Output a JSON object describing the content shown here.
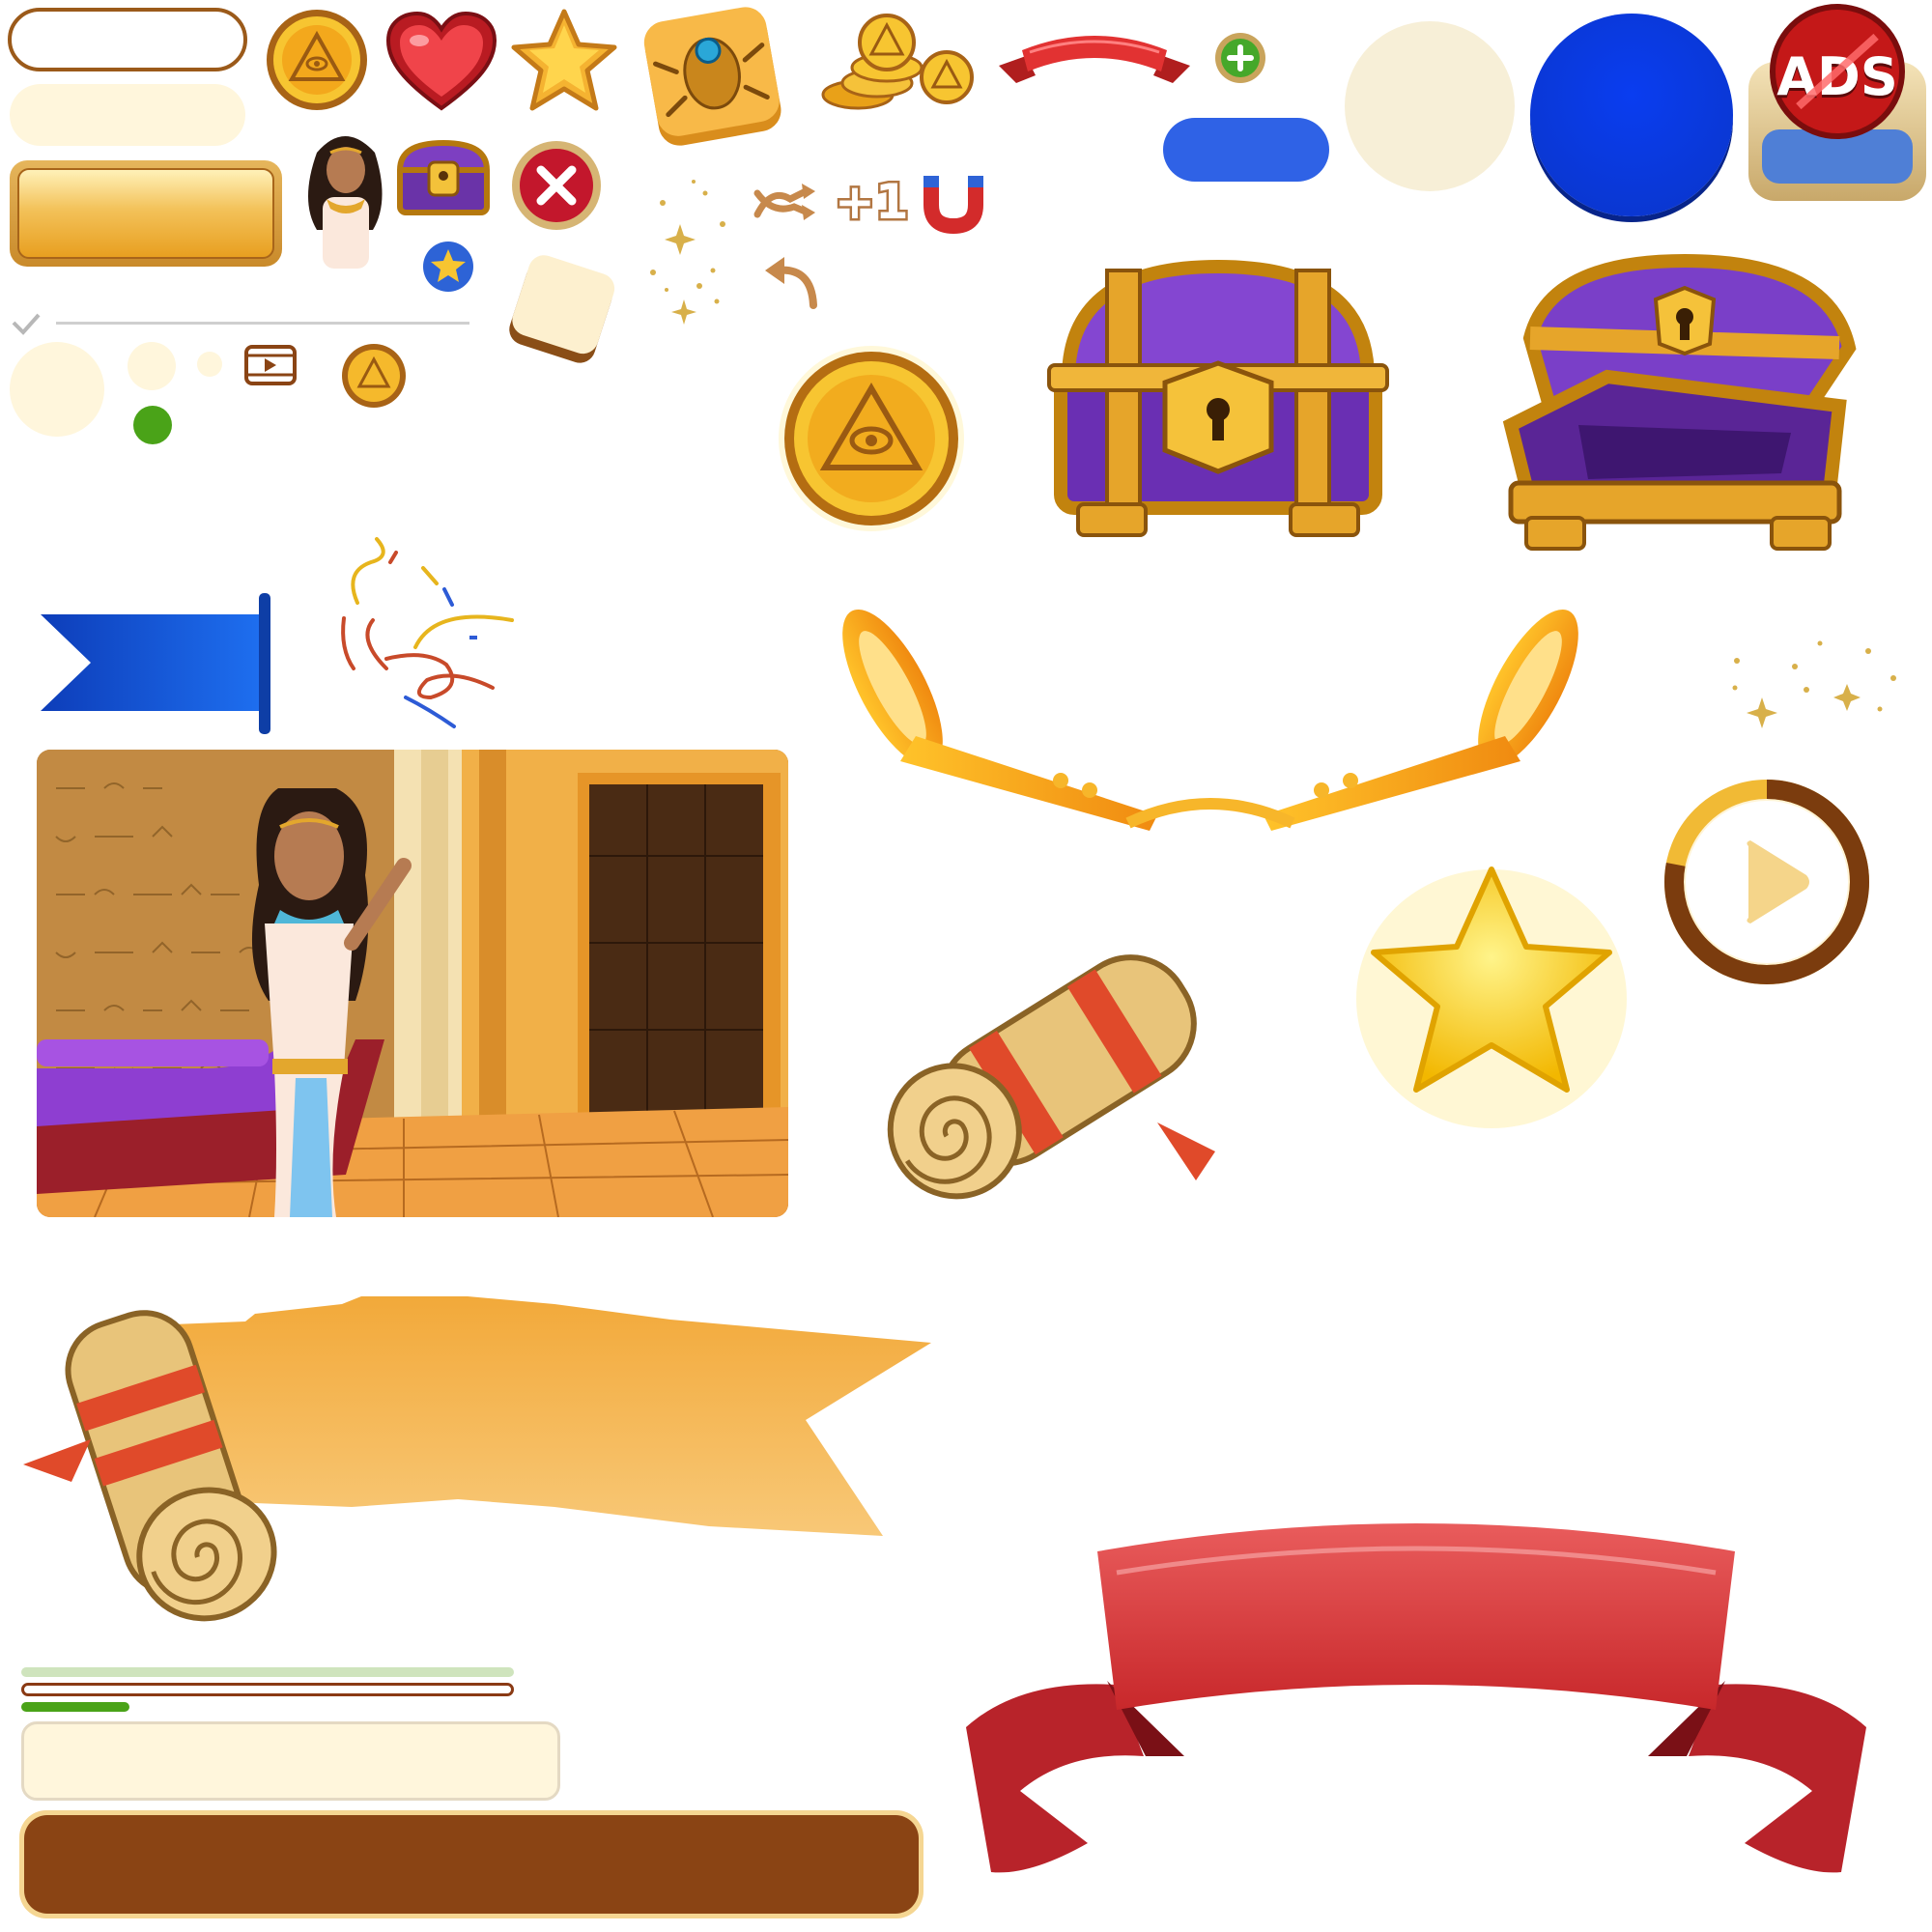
{
  "sheet": {
    "ads_badge_text": "ADS",
    "plus_one_text": "+1"
  },
  "colors": {
    "panel_cream": "#fff6dc",
    "button_blue": "#2f62e6",
    "circle_blue": "#0c3ae6",
    "banner_red": "#d63a3a",
    "progress_green": "#4aa318",
    "bar_brown": "#8a4414",
    "gold": "#f2b531"
  },
  "progress": {
    "green_bar_fraction": 0.22,
    "timer_ring_fraction": 0.78
  },
  "icons": [
    "eye-pyramid-coin-icon",
    "heart-icon",
    "star-icon",
    "scarab-tile-icon",
    "coin-pile-icon",
    "red-ribbon-small-icon",
    "plus-circle-icon",
    "close-x-icon",
    "treasure-chest-small-icon",
    "sparkles-icon",
    "shuffle-icon",
    "magnet-icon",
    "undo-arrow-icon",
    "video-icon",
    "treasure-chest-closed-icon",
    "treasure-chest-open-icon",
    "confetti-icon",
    "trumpets-icon",
    "scroll-icon",
    "star-large-icon",
    "play-timer-icon",
    "red-ribbon-banner-icon"
  ]
}
